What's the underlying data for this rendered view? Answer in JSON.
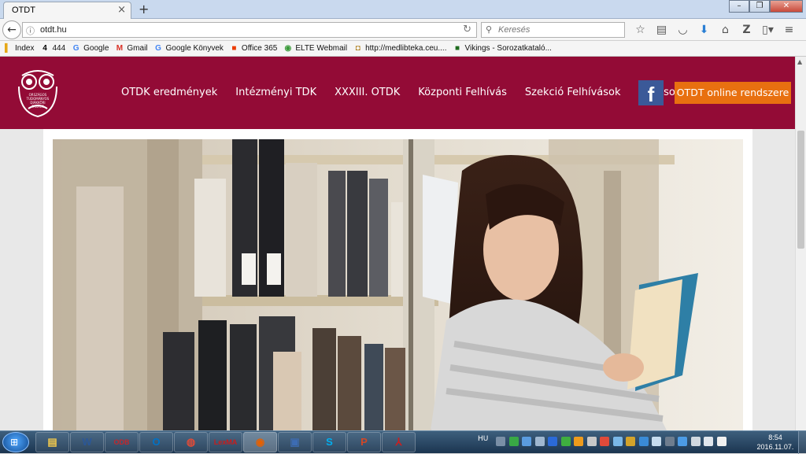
{
  "browser": {
    "tab_title": "OTDT",
    "tab_close": "×",
    "new_tab": "+",
    "url": "otdt.hu",
    "search_placeholder": "Keresés",
    "window_controls": [
      "–",
      "❐",
      "✕"
    ],
    "nav_icons": [
      "star-icon",
      "reading-list-icon",
      "pocket-icon",
      "download-icon",
      "home-icon",
      "zotero-icon",
      "page-icon",
      "menu-icon"
    ]
  },
  "bookmarks": [
    {
      "label": "Index",
      "icon": "index-icon",
      "color": "#e6a817",
      "glyph": "▌"
    },
    {
      "label": "444",
      "icon": "444-icon",
      "color": "#000000",
      "glyph": "4"
    },
    {
      "label": "Google",
      "icon": "google-icon",
      "color": "#4285f4",
      "glyph": "G"
    },
    {
      "label": "Gmail",
      "icon": "gmail-icon",
      "color": "#d93025",
      "glyph": "M"
    },
    {
      "label": "Google Könyvek",
      "icon": "google-books-icon",
      "color": "#4285f4",
      "glyph": "G"
    },
    {
      "label": "Office 365",
      "icon": "office-icon",
      "color": "#eb3c00",
      "glyph": "■"
    },
    {
      "label": "ELTE Webmail",
      "icon": "elte-icon",
      "color": "#3a9a3a",
      "glyph": "◉"
    },
    {
      "label": "http://medlibteka.ceu....",
      "icon": "medlib-icon",
      "color": "#b08020",
      "glyph": "◘"
    },
    {
      "label": "Vikings - Sorozatkataló...",
      "icon": "vikings-icon",
      "color": "#1e6b1e",
      "glyph": "■"
    }
  ],
  "site": {
    "logo_text": "ORSZÁGOS TUDOMÁNYOS DIÁKKÖRI TANÁCS",
    "menu": [
      "OTDK eredmények",
      "Intézményi TDK",
      "XXXIII. OTDK",
      "Központi Felhívás",
      "Szekció Felhívások",
      "Kapcsolat"
    ],
    "facebook_glyph": "f",
    "cta_label": "OTDT online rendszere",
    "brand_color": "#930b36",
    "cta_color": "#e87010"
  },
  "taskbar": {
    "apps": [
      {
        "name": "explorer",
        "glyph": "▤",
        "color": "#f2c94c"
      },
      {
        "name": "word",
        "glyph": "W",
        "color": "#2b5797"
      },
      {
        "name": "odb",
        "glyph": "ODB",
        "color": "#c1272d"
      },
      {
        "name": "outlook",
        "glyph": "O",
        "color": "#0072c6"
      },
      {
        "name": "chrome",
        "glyph": "◍",
        "color": "#dd4b39"
      },
      {
        "name": "lexma",
        "glyph": "LexMA",
        "color": "#c71d1d"
      },
      {
        "name": "firefox",
        "glyph": "◉",
        "color": "#e66000"
      },
      {
        "name": "save",
        "glyph": "▣",
        "color": "#3d6cb3"
      },
      {
        "name": "skype",
        "glyph": "S",
        "color": "#00aff0"
      },
      {
        "name": "powerpoint",
        "glyph": "P",
        "color": "#d24726"
      },
      {
        "name": "acrobat",
        "glyph": "⅄",
        "color": "#cc1f1f"
      }
    ],
    "language": "HU",
    "time": "8:54",
    "date": "2016.11.07."
  }
}
